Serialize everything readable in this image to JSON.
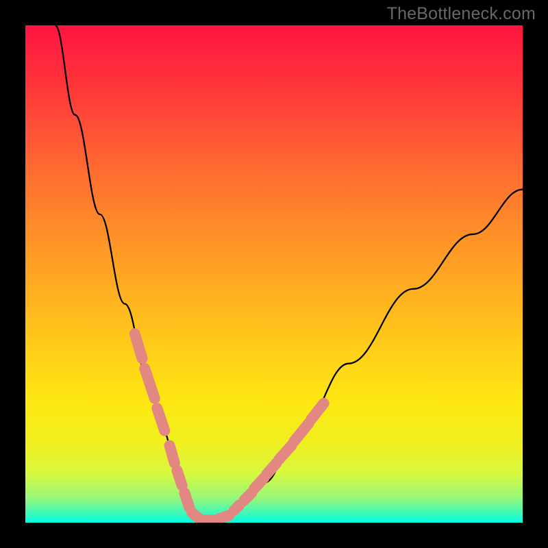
{
  "watermark": "TheBottleneck.com",
  "chart_data": {
    "type": "line",
    "title": "",
    "xlabel": "",
    "ylabel": "",
    "xlim": [
      0,
      100
    ],
    "ylim": [
      0,
      100
    ],
    "series": [
      {
        "name": "curve",
        "x": [
          6,
          10,
          15,
          20,
          25,
          28,
          30,
          32,
          33,
          34,
          35,
          36,
          38,
          40,
          43,
          48,
          55,
          65,
          78,
          90,
          100
        ],
        "y": [
          100,
          82,
          62,
          44,
          28,
          18,
          12,
          7,
          4,
          2,
          1,
          0.5,
          0.5,
          1,
          3,
          8,
          18,
          32,
          47,
          58,
          67
        ]
      }
    ],
    "markers": [
      {
        "x_start": 22,
        "y_start": 38,
        "x_end": 23.5,
        "y_end": 33
      },
      {
        "x_start": 24,
        "y_start": 31,
        "x_end": 26,
        "y_end": 25
      },
      {
        "x_start": 26.5,
        "y_start": 23,
        "x_end": 28,
        "y_end": 18.5
      },
      {
        "x_start": 29,
        "y_start": 15.5,
        "x_end": 30,
        "y_end": 12
      },
      {
        "x_start": 30.5,
        "y_start": 10.5,
        "x_end": 31.5,
        "y_end": 7.5
      },
      {
        "x_start": 32,
        "y_start": 6,
        "x_end": 33,
        "y_end": 3
      },
      {
        "x_start": 33.5,
        "y_start": 2,
        "x_end": 35,
        "y_end": 0.8
      },
      {
        "x_start": 35.5,
        "y_start": 0.5,
        "x_end": 38,
        "y_end": 0.5
      },
      {
        "x_start": 38.5,
        "y_start": 0.6,
        "x_end": 41,
        "y_end": 1.5
      },
      {
        "x_start": 42,
        "y_start": 2.5,
        "x_end": 43,
        "y_end": 3.5
      },
      {
        "x_start": 44,
        "y_start": 4.5,
        "x_end": 45.5,
        "y_end": 6
      },
      {
        "x_start": 46,
        "y_start": 6.8,
        "x_end": 48,
        "y_end": 9
      },
      {
        "x_start": 48.5,
        "y_start": 9.7,
        "x_end": 50.5,
        "y_end": 12
      },
      {
        "x_start": 51,
        "y_start": 12.7,
        "x_end": 53.5,
        "y_end": 15.5
      },
      {
        "x_start": 54,
        "y_start": 16.3,
        "x_end": 57,
        "y_end": 20
      },
      {
        "x_start": 57.5,
        "y_start": 20.8,
        "x_end": 60,
        "y_end": 24
      }
    ],
    "marker_color": "#e38782",
    "curve_color": "#000000"
  }
}
